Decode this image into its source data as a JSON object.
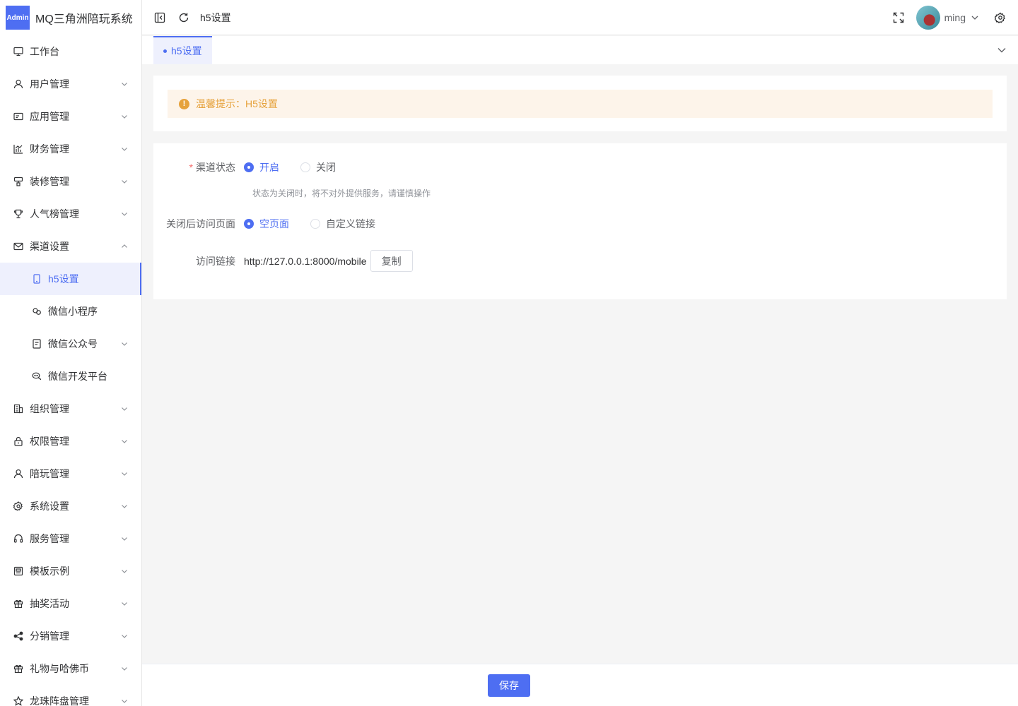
{
  "app": {
    "logo_badge": "Admin",
    "title": "MQ三角洲陪玩系统"
  },
  "sidebar": {
    "items": [
      {
        "label": "工作台",
        "icon": "monitor-icon",
        "has_chevron": false
      },
      {
        "label": "用户管理",
        "icon": "user-icon",
        "has_chevron": true
      },
      {
        "label": "应用管理",
        "icon": "app-card-icon",
        "has_chevron": true
      },
      {
        "label": "财务管理",
        "icon": "chart-icon",
        "has_chevron": true
      },
      {
        "label": "装修管理",
        "icon": "brush-icon",
        "has_chevron": true
      },
      {
        "label": "人气榜管理",
        "icon": "trophy-icon",
        "has_chevron": true
      },
      {
        "label": "渠道设置",
        "icon": "mail-icon",
        "has_chevron": true,
        "expanded": true
      },
      {
        "label": "h5设置",
        "icon": "phone-icon",
        "sub": true,
        "active": true
      },
      {
        "label": "微信小程序",
        "icon": "miniprogram-icon",
        "sub": true
      },
      {
        "label": "微信公众号",
        "icon": "doc-icon",
        "sub": true,
        "has_chevron": true
      },
      {
        "label": "微信开发平台",
        "icon": "chat-icon",
        "sub": true
      },
      {
        "label": "组织管理",
        "icon": "building-icon",
        "has_chevron": true
      },
      {
        "label": "权限管理",
        "icon": "lock-icon",
        "has_chevron": true
      },
      {
        "label": "陪玩管理",
        "icon": "person-icon",
        "has_chevron": true
      },
      {
        "label": "系统设置",
        "icon": "gear-icon",
        "has_chevron": true
      },
      {
        "label": "服务管理",
        "icon": "headset-icon",
        "has_chevron": true
      },
      {
        "label": "模板示例",
        "icon": "template-icon",
        "has_chevron": true
      },
      {
        "label": "抽奖活动",
        "icon": "gift-icon",
        "has_chevron": true
      },
      {
        "label": "分销管理",
        "icon": "share-icon",
        "has_chevron": true
      },
      {
        "label": "礼物与哈佛币",
        "icon": "gift-box-icon",
        "has_chevron": true
      },
      {
        "label": "龙珠阵盘管理",
        "icon": "star-icon",
        "has_chevron": true
      }
    ]
  },
  "header": {
    "breadcrumb": "h5设置",
    "username": "ming"
  },
  "tabs": [
    {
      "label": "h5设置",
      "active": true
    }
  ],
  "alert": {
    "text": "温馨提示：H5设置"
  },
  "form": {
    "channel_status": {
      "label": "渠道状态",
      "required": true,
      "options": [
        "开启",
        "关闭"
      ],
      "selected": "开启",
      "help": "状态为关闭时，将不对外提供服务，请谨慎操作"
    },
    "closed_page": {
      "label": "关闭后访问页面",
      "options": [
        "空页面",
        "自定义链接"
      ],
      "selected": "空页面"
    },
    "access_link": {
      "label": "访问链接",
      "value": "http://127.0.0.1:8000/mobile",
      "copy_label": "复制"
    }
  },
  "footer": {
    "save_label": "保存"
  },
  "colors": {
    "primary": "#4e6ef2",
    "warning": "#e6a23c",
    "warning_bg": "#fdf4ea",
    "required": "#f56c6c"
  }
}
